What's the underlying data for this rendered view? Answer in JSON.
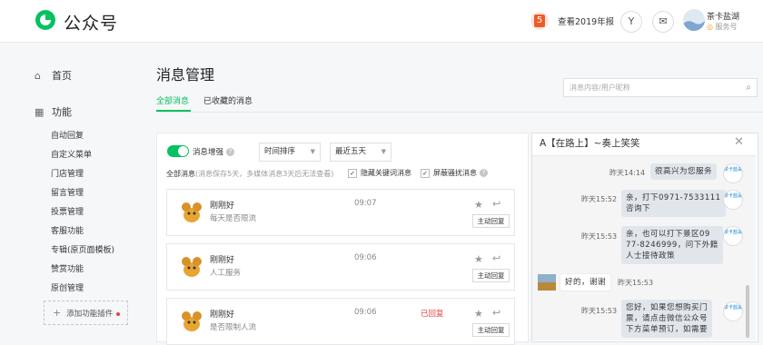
{
  "header": {
    "brand": "公众号",
    "report_label": "查看2019年报",
    "account_name": "茶卡盐湖",
    "account_type": "服务号"
  },
  "sidebar": {
    "home": "首页",
    "functions": "功能",
    "items": [
      "自动回复",
      "自定义菜单",
      "门店管理",
      "留言管理",
      "投票管理",
      "客服功能",
      "专辑(原页面模板)",
      "赞赏功能",
      "原创管理"
    ],
    "add_plugin": "添加功能插件"
  },
  "main": {
    "title": "消息管理",
    "tabs": [
      "全部消息",
      "已收藏的消息"
    ],
    "search_placeholder": "消息内容/用户昵称"
  },
  "filters": {
    "enhance_label": "消息增强",
    "sort_select": "时间排序",
    "range_select": "最近五天",
    "all_label": "全部消息",
    "all_note": "(消息保存5天，多媒体消息3天后无法查看)",
    "hide_keyword": "隐藏关键词消息",
    "block_harass": "屏蔽骚扰消息"
  },
  "messages": [
    {
      "name": "刚刚好",
      "text": "每天是否限流",
      "time": "09:07",
      "status": "",
      "reply_btn": "主动回复"
    },
    {
      "name": "刚刚好",
      "text": "人工服务",
      "time": "09:06",
      "status": "",
      "reply_btn": "主动回复"
    },
    {
      "name": "刚刚好",
      "text": "是否限制人流",
      "time": "09:06",
      "status": "已回复",
      "reply_btn": "主动回复"
    }
  ],
  "chat": {
    "title": "A【在路上】~奏上笑笑",
    "logo_text": "茶卡盐湖",
    "entries": [
      {
        "time": "昨天14:14",
        "text": "很高兴为您服务"
      },
      {
        "time": "昨天15:52",
        "text1": "亲，打下0971-7533111",
        "text2": "咨询下"
      },
      {
        "time": "昨天15:53",
        "text1": "亲，也可以打下景区09",
        "text2": "77-8246999，问下外籍",
        "text3": "人士接待政策"
      },
      {
        "time": "昨天15:53",
        "text": "好的，谢谢"
      },
      {
        "time": "昨天15:53",
        "text1": "您好，如果您想购买门",
        "text2": "票，请点击微信公众号",
        "text3": "下方菜单预订，如需要"
      }
    ]
  },
  "colors": {
    "accent": "#07c160",
    "danger": "#e64340"
  }
}
